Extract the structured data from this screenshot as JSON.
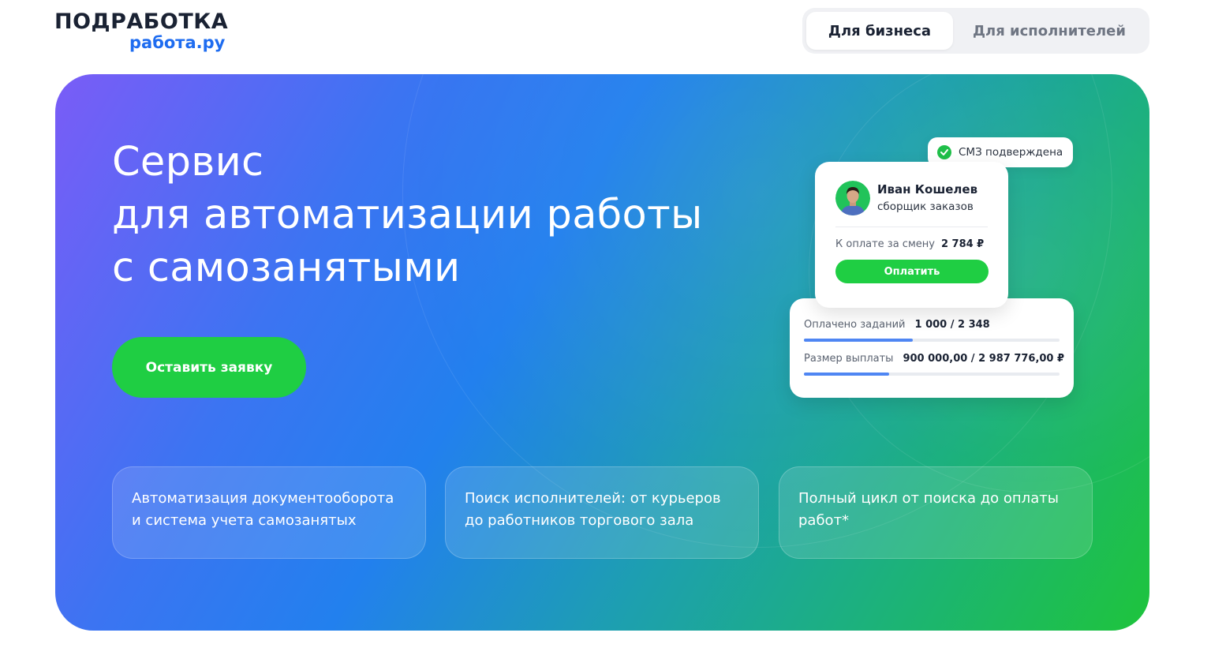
{
  "header": {
    "logo_top": "ПОДРАБОТКА",
    "logo_bottom": "работа.ру",
    "tabs": [
      {
        "label": "Для бизнеса",
        "active": true
      },
      {
        "label": "Для исполнителей",
        "active": false
      }
    ]
  },
  "hero": {
    "title_lines": [
      "Сервис",
      "для автоматизации работы",
      "с самозанятыми"
    ],
    "cta_label": "Оставить заявку",
    "features": [
      "Автоматизация документооборота и система учета самозанятых",
      "Поиск исполнителей: от курьеров до работников торгового зала",
      "Полный цикл от поиска до оплаты работ*"
    ]
  },
  "mockup": {
    "badge": "СМЗ подверждена",
    "worker": {
      "name": "Иван Кошелев",
      "role": "сборщик заказов",
      "pay_label": "К оплате за смену",
      "pay_value": "2 784 ₽",
      "pay_button": "Оплатить"
    },
    "stats": [
      {
        "label": "Оплачено заданий",
        "value": "1 000 / 2 348",
        "progress": 0.426
      },
      {
        "label": "Размер выплаты",
        "value": "900 000,00 / 2 987 776,00 ₽",
        "progress": 0.334
      }
    ]
  },
  "colors": {
    "accent_green": "#1fce43",
    "brand_blue": "#1e6cf0",
    "text_dark": "#1a2233"
  }
}
